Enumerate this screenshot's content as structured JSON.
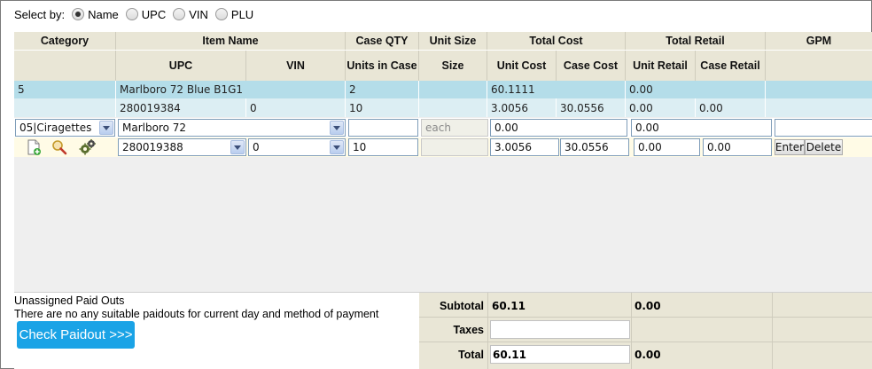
{
  "select_by": {
    "label": "Select by:",
    "options": [
      {
        "label": "Name",
        "selected": true
      },
      {
        "label": "UPC",
        "selected": false
      },
      {
        "label": "VIN",
        "selected": false
      },
      {
        "label": "PLU",
        "selected": false
      }
    ]
  },
  "headers": {
    "row1": {
      "category": "Category",
      "item_name": "Item Name",
      "case_qty": "Case QTY",
      "unit_size": "Unit Size",
      "total_cost": "Total Cost",
      "total_retail": "Total Retail",
      "gpm": "GPM"
    },
    "row2": {
      "upc": "UPC",
      "vin": "VIN",
      "units_in_case": "Units in Case",
      "size": "Size",
      "unit_cost": "Unit Cost",
      "case_cost": "Case Cost",
      "unit_retail": "Unit Retail",
      "case_retail": "Case Retail"
    }
  },
  "item": {
    "category": "5",
    "name": "Marlboro 72 Blue B1G1",
    "case_qty": "2",
    "total_cost": "60.1111",
    "total_retail": "0.00",
    "upc": "280019384",
    "vin": "0",
    "units_in_case": "10",
    "unit_cost": "3.0056",
    "case_cost": "30.0556",
    "unit_retail": "0.00",
    "case_retail": "0.00"
  },
  "edit": {
    "category": "05|Ciragettes",
    "item_name": "Marlboro 72",
    "case_qty": "",
    "unit_size_placeholder": "each",
    "total_cost": "0.00",
    "total_retail": "0.00",
    "gpm": "",
    "upc": "280019388",
    "vin": "0",
    "units_in_case": "10",
    "unit_cost": "3.0056",
    "case_cost": "30.0556",
    "unit_retail": "0.00",
    "case_retail": "0.00",
    "enter_label": "Enter",
    "delete_label": "Delete"
  },
  "icons": [
    "new-document-icon",
    "search-icon",
    "settings-gears-icon"
  ],
  "paidouts": {
    "title": "Unassigned Paid Outs",
    "message": "There are no any suitable paidouts for current day and method of payment",
    "button": "Check Paidout >>>"
  },
  "totals": {
    "subtotal_label": "Subtotal",
    "subtotal_cost": "60.11",
    "subtotal_retail": "0.00",
    "taxes_label": "Taxes",
    "taxes_value": "",
    "total_label": "Total",
    "total_cost": "60.11",
    "total_retail": "0.00"
  },
  "colors": {
    "header_bg": "#e9e6d6",
    "selected_row_bg": "#b4dde9",
    "sub_row_bg": "#dceef3",
    "edit_row_bg": "#fffbe6",
    "button_blue": "#1aa3e6"
  }
}
